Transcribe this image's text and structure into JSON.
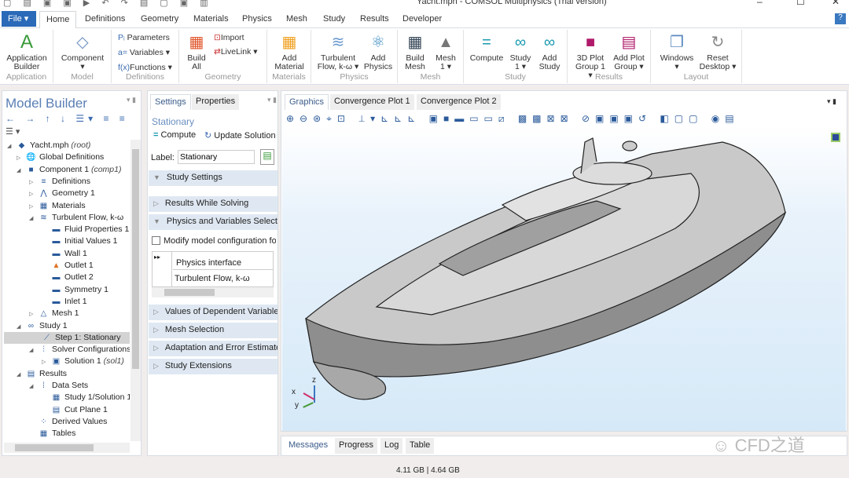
{
  "window": {
    "title": "Yacht.mph - COMSOL Multiphysics (Trial version)",
    "minimize": "–",
    "maximize": "☐",
    "close": "✕"
  },
  "ribbon": {
    "file": "File ▾",
    "tabs": [
      "Home",
      "Definitions",
      "Geometry",
      "Materials",
      "Physics",
      "Mesh",
      "Study",
      "Results",
      "Developer"
    ],
    "help": "?",
    "groups": {
      "application": "Application",
      "model": "Model",
      "definitions": "Definitions",
      "geometry": "Geometry",
      "materials": "Materials",
      "physics": "Physics",
      "mesh": "Mesh",
      "study": "Study",
      "results": "Results",
      "layout": "Layout"
    },
    "buttons": {
      "app_builder": "Application Builder",
      "component": "Component ▾",
      "parameters": "Parameters",
      "variables": "Variables ▾",
      "functions": "Functions ▾",
      "build_all": "Build All",
      "import": "Import",
      "livelink": "LiveLink ▾",
      "add_material": "Add Material",
      "turbulent": "Turbulent Flow, k-ω ▾",
      "add_physics": "Add Physics",
      "build_mesh": "Build Mesh",
      "mesh1": "Mesh 1 ▾",
      "compute": "Compute",
      "study1": "Study 1 ▾",
      "add_study": "Add Study",
      "plot3d": "3D Plot Group 1 ▾",
      "add_plot": "Add Plot Group ▾",
      "windows": "Windows ▾",
      "reset": "Reset Desktop ▾"
    }
  },
  "model_builder": {
    "title": "Model Builder",
    "tree": [
      {
        "label": "Yacht.mph",
        "tag": "(root)",
        "icon": "◆",
        "level": 0,
        "exp": "◢"
      },
      {
        "label": "Global Definitions",
        "icon": "🌐",
        "level": 1,
        "exp": "▷"
      },
      {
        "label": "Component 1",
        "tag": "(comp1)",
        "icon": "■",
        "level": 1,
        "exp": "◢"
      },
      {
        "label": "Definitions",
        "icon": "≡",
        "level": 2,
        "exp": "▷"
      },
      {
        "label": "Geometry 1",
        "icon": "⋀",
        "level": 2,
        "exp": "▷"
      },
      {
        "label": "Materials",
        "icon": "▦",
        "level": 2,
        "exp": "▷"
      },
      {
        "label": "Turbulent Flow, k-ω",
        "icon": "≋",
        "level": 2,
        "exp": "◢"
      },
      {
        "label": "Fluid Properties 1",
        "icon": "▬",
        "level": 3
      },
      {
        "label": "Initial Values 1",
        "icon": "▬",
        "level": 3
      },
      {
        "label": "Wall 1",
        "icon": "▬",
        "level": 3
      },
      {
        "label": "Outlet 1",
        "icon": "▲",
        "level": 3
      },
      {
        "label": "Outlet 2",
        "icon": "▬",
        "level": 3
      },
      {
        "label": "Symmetry 1",
        "icon": "▬",
        "level": 3
      },
      {
        "label": "Inlet 1",
        "icon": "▬",
        "level": 3
      },
      {
        "label": "Mesh 1",
        "icon": "△",
        "level": 2,
        "exp": "▷"
      },
      {
        "label": "Study 1",
        "icon": "∞",
        "level": 1,
        "exp": "◢"
      },
      {
        "label": "Step 1: Stationary",
        "icon": "⟋",
        "level": 2,
        "selected": true
      },
      {
        "label": "Solver Configurations",
        "icon": "⫶",
        "level": 2,
        "exp": "◢"
      },
      {
        "label": "Solution 1",
        "tag": "(sol1)",
        "icon": "▣",
        "level": 3,
        "exp": "▷"
      },
      {
        "label": "Results",
        "icon": "▤",
        "level": 1,
        "exp": "◢"
      },
      {
        "label": "Data Sets",
        "icon": "⁞",
        "level": 2,
        "exp": "◢"
      },
      {
        "label": "Study 1/Solution 1",
        "icon": "▦",
        "level": 3
      },
      {
        "label": "Cut Plane 1",
        "icon": "▤",
        "level": 3
      },
      {
        "label": "Derived Values",
        "icon": "⁘",
        "level": 2
      },
      {
        "label": "Tables",
        "icon": "▦",
        "level": 2
      }
    ]
  },
  "settings": {
    "tabs": [
      "Settings",
      "Properties"
    ],
    "heading": "Stationary",
    "compute": "Compute",
    "update": "Update Solution",
    "label_caption": "Label:",
    "label_value": "Stationary",
    "sections": [
      "Study Settings",
      "Results While Solving",
      "Physics and Variables Selection",
      "Values of Dependent Variables",
      "Mesh Selection",
      "Adaptation and Error Estimates",
      "Study Extensions"
    ],
    "modify_checkbox": "Modify model configuration for study step",
    "table_header": "Physics interface",
    "table_row": "Turbulent Flow, k-ω"
  },
  "graphics": {
    "tabs": [
      "Graphics",
      "Convergence Plot 1",
      "Convergence Plot 2"
    ],
    "axes": {
      "x": "x",
      "y": "y",
      "z": "z"
    }
  },
  "messages": {
    "tabs": [
      "Messages",
      "Progress",
      "Log",
      "Table"
    ],
    "watermark": "CFD之道"
  },
  "status": {
    "memory": "4.11 GB | 4.64 GB"
  },
  "colors": {
    "accent": "#2a6ab8",
    "viewport": "#d6e9f8",
    "section": "#dfe8f2"
  }
}
